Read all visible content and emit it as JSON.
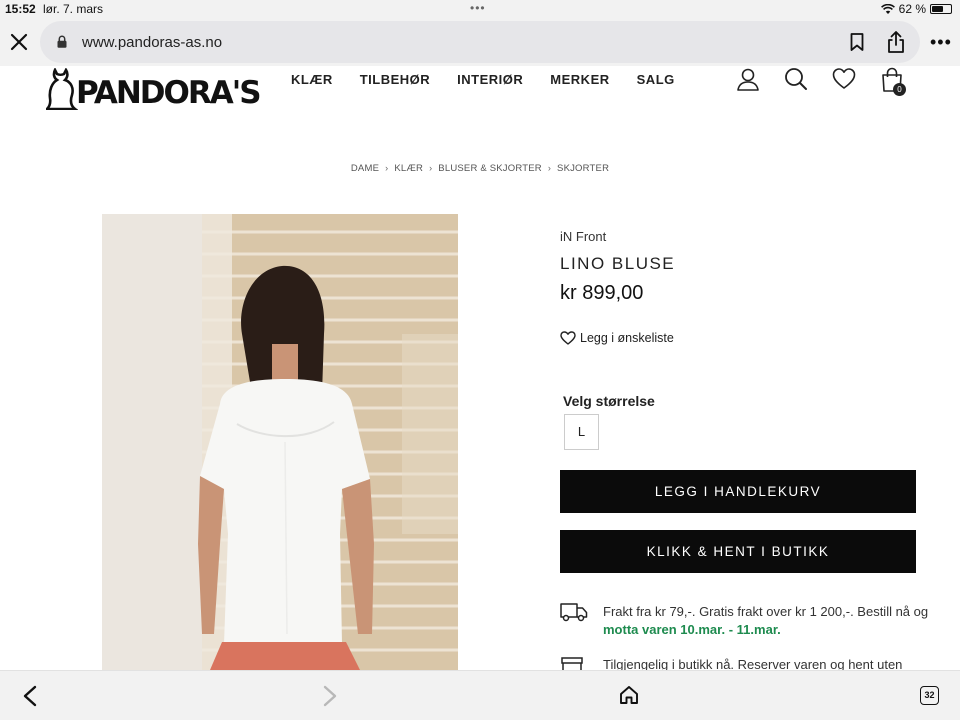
{
  "status_bar": {
    "time": "15:52",
    "date": "lør. 7. mars",
    "battery_percent": "62 %",
    "battery_level": 0.62,
    "dots": "•••"
  },
  "browser": {
    "url": "www.pandoras-as.no",
    "more": "•••"
  },
  "site": {
    "logo_text": "PANDORA'S",
    "nav": [
      "KLÆR",
      "TILBEHØR",
      "INTERIØR",
      "MERKER",
      "SALG"
    ],
    "cart_count": "0"
  },
  "breadcrumb": [
    "DAME",
    "KLÆR",
    "BLUSER & SKJORTER",
    "SKJORTER"
  ],
  "product": {
    "brand": "iN Front",
    "name": "LINO BLUSE",
    "price": "kr 899,00",
    "wishlist_label": "Legg i ønskeliste",
    "size_label": "Velg størrelse",
    "sizes": [
      "L"
    ],
    "add_to_cart": "LEGG I HANDLEKURV",
    "click_collect": "KLIKK & HENT I BUTIKK",
    "shipping_text": "Frakt fra kr 79,-. Gratis frakt over kr 1 200,-. Bestill nå og",
    "shipping_highlight": "motta varen 10.mar. - 11.mar.",
    "store_text": "Tilgjengelig i butikk nå. Reserver varen og hent uten"
  },
  "toolbar": {
    "tab_count": "32"
  },
  "colors": {
    "button_bg": "#0b0b0b",
    "accent_green": "#1e8b4f",
    "chrome_bg": "#f2f2f2"
  }
}
